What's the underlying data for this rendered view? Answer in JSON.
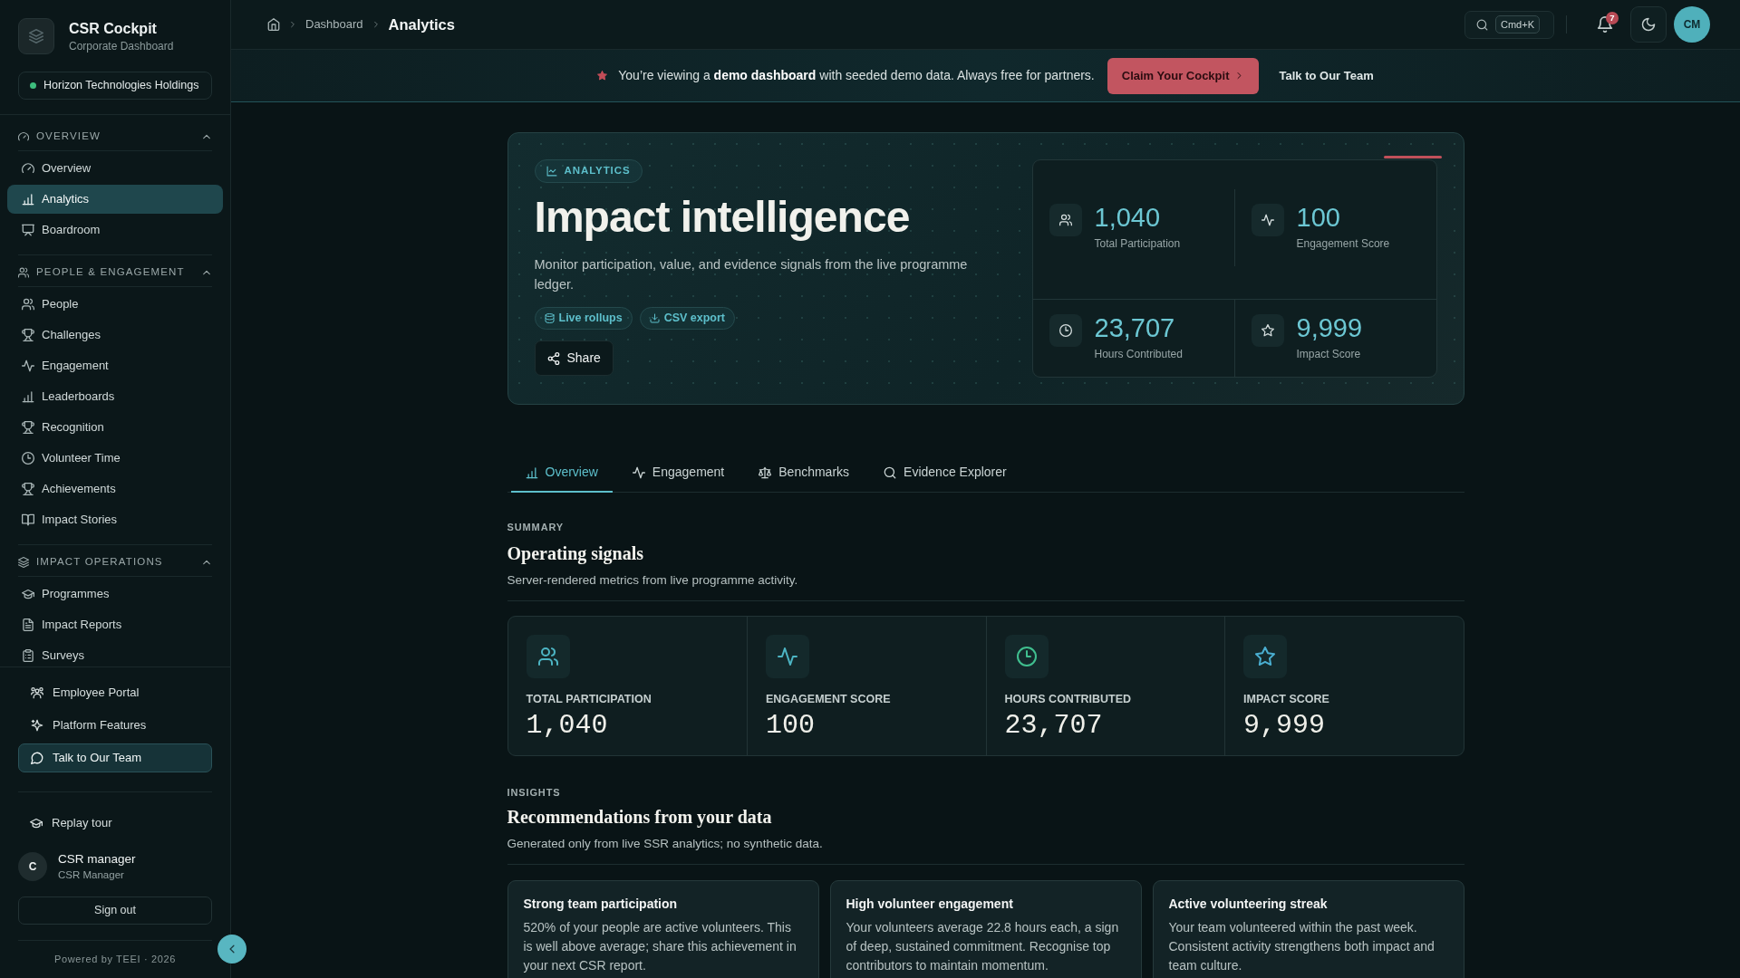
{
  "sidebar": {
    "brand": {
      "title": "CSR Cockpit",
      "subtitle": "Corporate Dashboard"
    },
    "organization": "Horizon Technologies Holdings",
    "sections": [
      {
        "title": "OVERVIEW",
        "expanded": true,
        "items": [
          {
            "label": "Overview",
            "selected": false
          },
          {
            "label": "Analytics",
            "selected": true
          },
          {
            "label": "Boardroom",
            "selected": false
          }
        ]
      },
      {
        "title": "PEOPLE & ENGAGEMENT",
        "expanded": true,
        "items": [
          {
            "label": "People",
            "selected": false
          },
          {
            "label": "Challenges",
            "selected": false
          },
          {
            "label": "Engagement",
            "selected": false
          },
          {
            "label": "Leaderboards",
            "selected": false
          },
          {
            "label": "Recognition",
            "selected": false
          },
          {
            "label": "Volunteer Time",
            "selected": false
          },
          {
            "label": "Achievements",
            "selected": false
          },
          {
            "label": "Impact Stories",
            "selected": false
          }
        ]
      },
      {
        "title": "IMPACT OPERATIONS",
        "expanded": true,
        "items": [
          {
            "label": "Programmes",
            "selected": false
          },
          {
            "label": "Impact Reports",
            "selected": false
          },
          {
            "label": "Surveys",
            "selected": false
          }
        ]
      }
    ],
    "links": [
      {
        "label": "Employee Portal",
        "kind": "link"
      },
      {
        "label": "Platform Features",
        "kind": "link"
      },
      {
        "label": "Talk to Our Team",
        "kind": "cta"
      }
    ],
    "replay_tour": "Replay tour",
    "user": {
      "initial": "C",
      "name": "CSR manager",
      "role": "CSR Manager"
    },
    "sign_out": "Sign out",
    "footer": "Powered by TEEI · 2026"
  },
  "topbar": {
    "breadcrumb": [
      {
        "label": "Dashboard",
        "current": false
      },
      {
        "label": "Analytics",
        "current": true
      }
    ],
    "search_shortcut": "Cmd+K",
    "notification_count": "7",
    "avatar_initials": "CM"
  },
  "banner": {
    "message": "You’re viewing a **demo dashboard** with seeded demo data. Always free for partners.",
    "primary_button": "Claim Your Cockpit",
    "secondary_link": "Talk to Our Team"
  },
  "hero": {
    "badge": "ANALYTICS",
    "title": "Impact intelligence",
    "description": "Monitor participation, value, and evidence signals from the live programme ledger.",
    "chips": [
      "Live rollups",
      "CSV export"
    ],
    "share_button": "Share",
    "stats": [
      {
        "value": "1,040",
        "label": "Total Participation"
      },
      {
        "value": "100",
        "label": "Engagement Score"
      },
      {
        "value": "23,707",
        "label": "Hours Contributed"
      },
      {
        "value": "9,999",
        "label": "Impact Score"
      }
    ]
  },
  "tabs": [
    {
      "label": "Overview",
      "selected": true
    },
    {
      "label": "Engagement",
      "selected": false
    },
    {
      "label": "Benchmarks",
      "selected": false
    },
    {
      "label": "Evidence Explorer",
      "selected": false
    }
  ],
  "summary": {
    "eyebrow": "SUMMARY",
    "title": "Operating signals",
    "description": "Server-rendered metrics from live programme activity.",
    "metrics": [
      {
        "label": "TOTAL PARTICIPATION",
        "value": "1,040",
        "color": "#4db5c4"
      },
      {
        "label": "ENGAGEMENT SCORE",
        "value": "100",
        "color": "#4db5c4"
      },
      {
        "label": "HOURS CONTRIBUTED",
        "value": "23,707",
        "color": "#40bf8f"
      },
      {
        "label": "IMPACT SCORE",
        "value": "9,999",
        "color": "#4aaed0"
      }
    ]
  },
  "insights": {
    "eyebrow": "INSIGHTS",
    "title": "Recommendations from your data",
    "description": "Generated only from live SSR analytics; no synthetic data.",
    "cards": [
      {
        "title": "Strong team participation",
        "body": "520% of your people are active volunteers. This is well above average; share this achievement in your next CSR report."
      },
      {
        "title": "High volunteer engagement",
        "body": "Your volunteers average 22.8 hours each, a sign of deep, sustained commitment. Recognise top contributors to maintain momentum."
      },
      {
        "title": "Active volunteering streak",
        "body": "Your team volunteered within the past week. Consistent activity strengthens both impact and team culture."
      }
    ]
  }
}
